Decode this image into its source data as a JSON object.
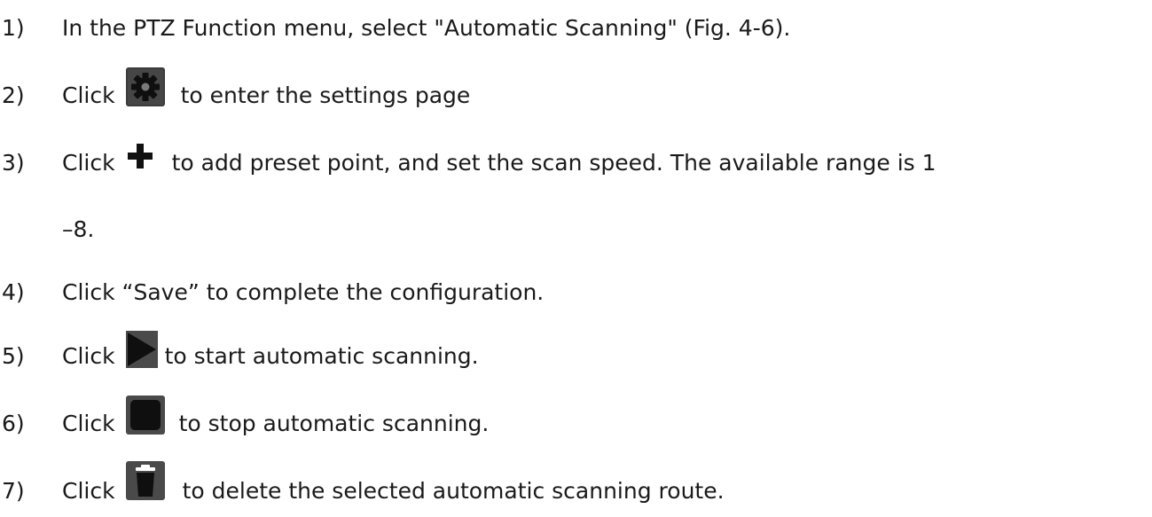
{
  "steps": [
    {
      "number": "1)",
      "text": "In the PTZ Function menu, select \"Automatic Scanning\" (Fig. 4-6)."
    },
    {
      "number": "2)",
      "prefix": "Click",
      "icon": "gear-icon",
      "text": "to enter the settings page"
    },
    {
      "number": "3)",
      "prefix": "Click",
      "icon": "plus-icon",
      "text": "to add preset point, and set the scan speed. The available range is 1",
      "continuation": "–8."
    },
    {
      "number": "4)",
      "text": "Click “Save” to complete the configuration."
    },
    {
      "number": "5)",
      "prefix": "Click",
      "icon": "play-icon",
      "text": "to start automatic scanning."
    },
    {
      "number": "6)",
      "prefix": "Click",
      "icon": "stop-icon",
      "text": "to stop automatic scanning."
    },
    {
      "number": "7)",
      "prefix": "Click",
      "icon": "trash-icon",
      "text": "to delete the selected automatic scanning route."
    }
  ],
  "colors": {
    "text": "#1a1a1a",
    "icon_dark": "#222222",
    "icon_bg": "#4a4a4a"
  }
}
